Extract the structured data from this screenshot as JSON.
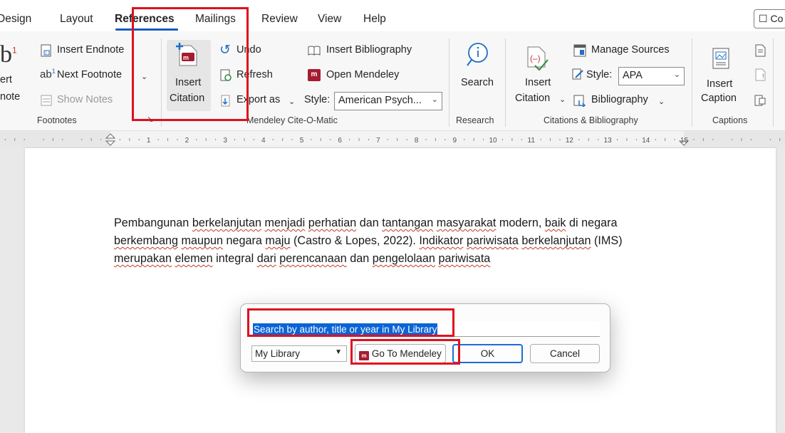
{
  "tabs": {
    "design": "Design",
    "layout": "Layout",
    "references": "References",
    "mailings": "Mailings",
    "review": "Review",
    "view": "View",
    "help": "Help",
    "comments": "Co"
  },
  "ribbon": {
    "footnotes": {
      "insert_endnote": "Insert Endnote",
      "next_footnote": "Next Footnote",
      "show_notes": "Show Notes",
      "insert_footnote_partial_1": "ert",
      "insert_footnote_partial_2": "note",
      "group_name": "Footnotes"
    },
    "mendeley": {
      "insert_citation_1": "Insert",
      "insert_citation_2": "Citation",
      "undo": "Undo",
      "refresh": "Refresh",
      "export_as": "Export as",
      "insert_bibliography": "Insert Bibliography",
      "open_mendeley": "Open Mendeley",
      "style_label": "Style:",
      "style_value": "American Psych...",
      "group_name": "Mendeley Cite-O-Matic"
    },
    "research": {
      "search": "Search",
      "group_name": "Research"
    },
    "citations": {
      "insert_citation_1": "Insert",
      "insert_citation_2": "Citation",
      "manage_sources": "Manage Sources",
      "style_label": "Style:",
      "style_value": "APA",
      "bibliography": "Bibliography",
      "group_name": "Citations & Bibliography"
    },
    "captions": {
      "insert_caption_1": "Insert",
      "insert_caption_2": "Caption",
      "group_name": "Captions"
    }
  },
  "ruler": {
    "numbers": [
      "1",
      "2",
      "3",
      "4",
      "5",
      "6",
      "7",
      "8",
      "9",
      "10",
      "11",
      "12",
      "13",
      "14",
      "15"
    ]
  },
  "document": {
    "line1": [
      "Pembangunan ",
      {
        "sq": "berkelanjutan"
      },
      " ",
      {
        "sq": "menjadi"
      },
      " ",
      {
        "sq": "perhatian"
      },
      " dan ",
      {
        "sq": "tantangan"
      },
      " ",
      {
        "sq": "masyarakat"
      },
      " modern, ",
      {
        "sq": "baik"
      },
      " di negara"
    ],
    "line2": [
      {
        "sq": "berkembang"
      },
      " ",
      {
        "sq": "maupun"
      },
      " negara ",
      {
        "sq": "maju"
      },
      " (Castro & Lopes, 2022). ",
      {
        "sq": "Indikator"
      },
      " ",
      {
        "sq": "pariwisata"
      },
      " ",
      {
        "sq": "berkelanjutan"
      },
      " (IMS)"
    ],
    "line3": [
      {
        "sq": "merupakan"
      },
      " ",
      {
        "sq": "elemen"
      },
      " integral ",
      {
        "sq": "dari"
      },
      " ",
      {
        "sq": "perencanaan"
      },
      " dan ",
      {
        "sq": "pengelolaan"
      },
      " ",
      {
        "sq": "pariwisata"
      }
    ]
  },
  "dialog": {
    "search_text": "Search by author, title or year in My Library",
    "library_value": "My Library",
    "go_to_mendeley": "Go To Mendeley",
    "ok": "OK",
    "cancel": "Cancel"
  },
  "colors": {
    "accent_blue": "#185abd",
    "highlight_red": "#e0101e",
    "mendeley_red": "#a51c30",
    "selection_blue": "#0a64d6"
  }
}
